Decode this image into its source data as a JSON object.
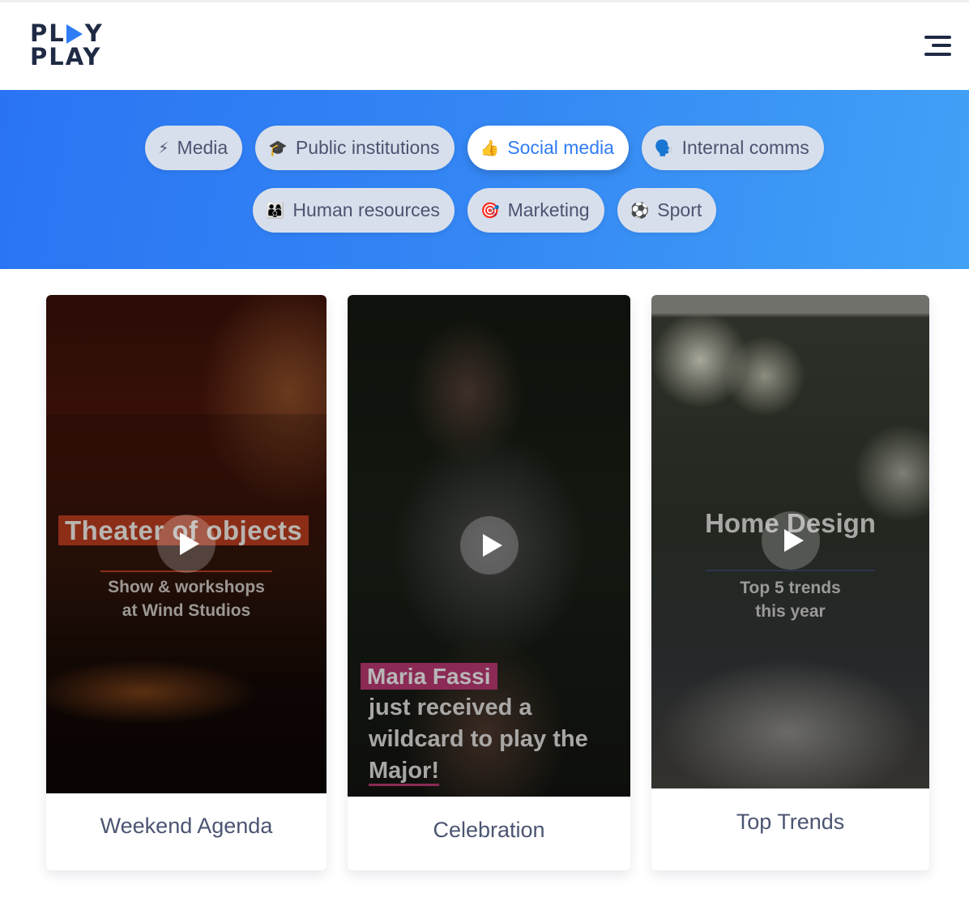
{
  "header": {
    "logo_line1_left": "PL",
    "logo_line1_right": "Y",
    "logo_line2": "PLAY",
    "logo_accent_color": "#2f7cf6",
    "menu_icon": "hamburger-menu-icon"
  },
  "categories": {
    "row1": [
      {
        "emoji": "⚡",
        "icon": "lightning-icon",
        "label": "Media",
        "active": false
      },
      {
        "emoji": "🎓",
        "icon": "graduation-cap-icon",
        "label": "Public institutions",
        "active": false
      },
      {
        "emoji": "👍",
        "icon": "thumbs-up-icon",
        "label": "Social media",
        "active": true
      },
      {
        "emoji": "🗣️",
        "icon": "speaking-head-icon",
        "label": "Internal comms",
        "active": false
      }
    ],
    "row2": [
      {
        "emoji": "👨‍👩‍👦",
        "icon": "family-icon",
        "label": "Human resources",
        "active": false
      },
      {
        "emoji": "🎯",
        "icon": "target-icon",
        "label": "Marketing",
        "active": false
      },
      {
        "emoji": "⚽",
        "icon": "soccer-ball-icon",
        "label": "Sport",
        "active": false
      }
    ],
    "active_color": "#2f7cf6"
  },
  "cards": [
    {
      "headline": "Theater of objects",
      "subtitle_line1": "Show & workshops",
      "subtitle_line2": "at Wind Studios",
      "title": "Weekend Agenda",
      "accent_color": "#8b2d17"
    },
    {
      "name": "Maria Fassi",
      "body_line1": "just received a",
      "body_line2": "wildcard to play the",
      "body_line3": "Major!",
      "title": "Celebration",
      "accent_color": "#8a2a55"
    },
    {
      "headline": "Home Design",
      "subtitle_line1": "Top 5 trends",
      "subtitle_line2": "this year",
      "title": "Top Trends",
      "accent_color": "#2d3550"
    }
  ]
}
